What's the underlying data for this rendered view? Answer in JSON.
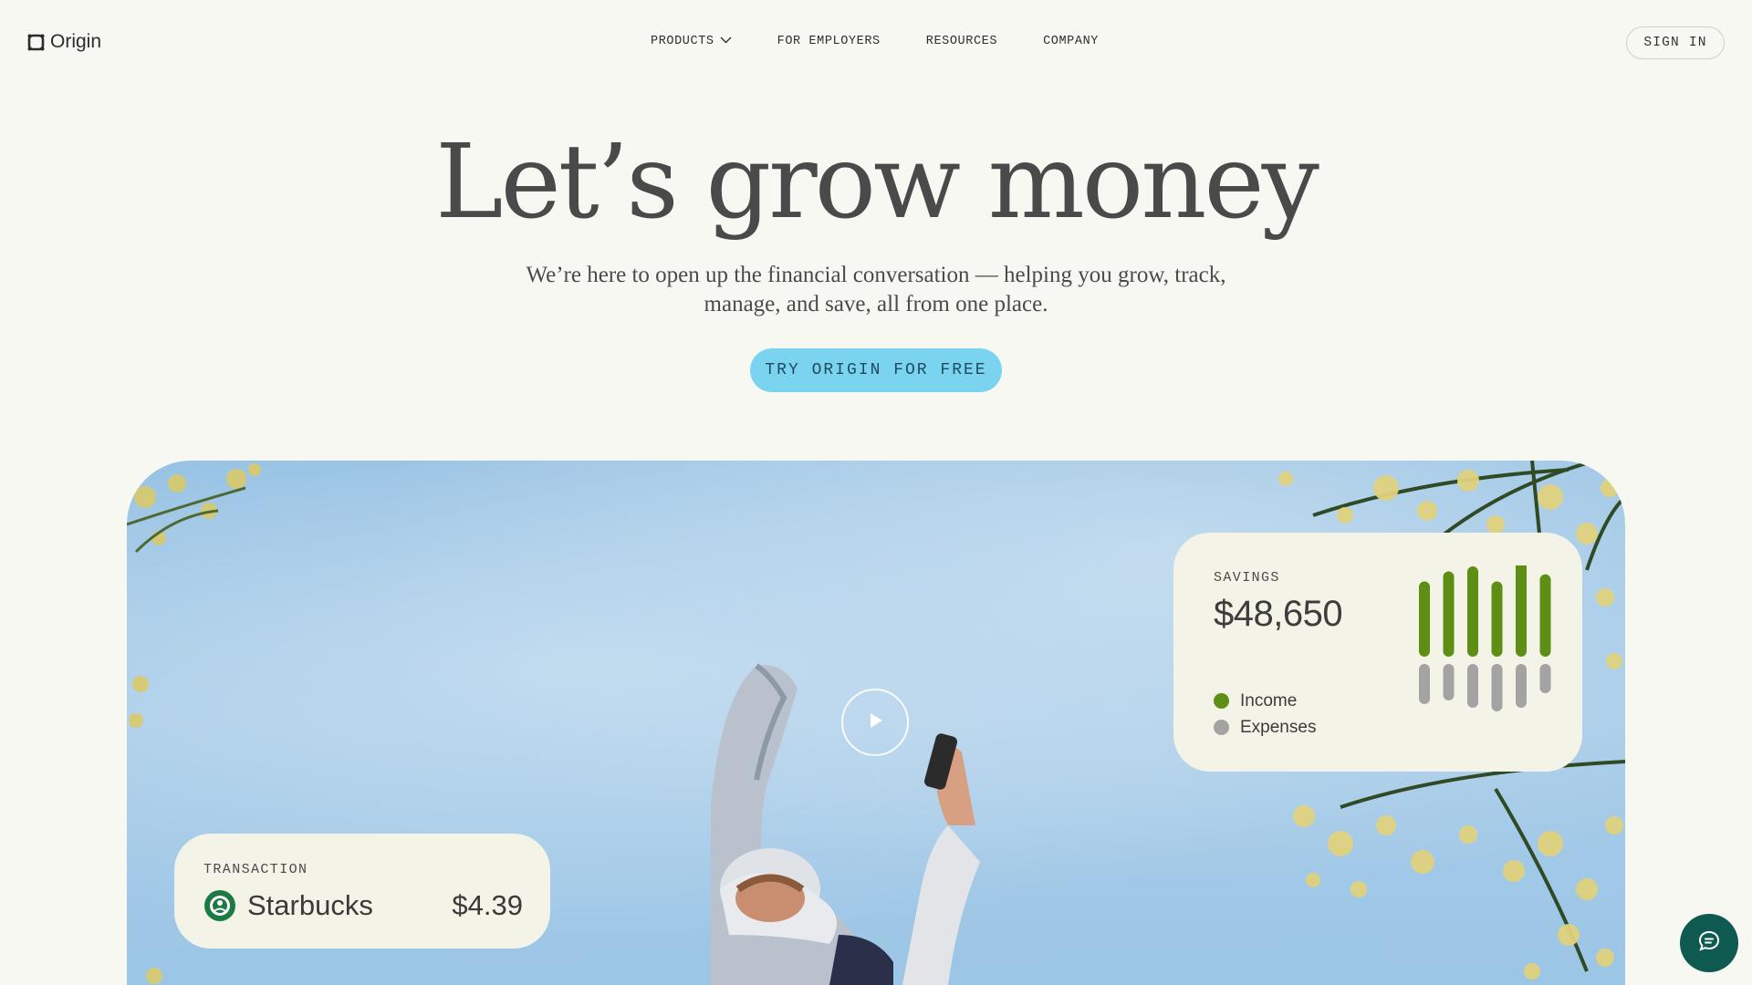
{
  "header": {
    "logo_text": "Origin",
    "nav": [
      {
        "label": "PRODUCTS",
        "has_dropdown": true
      },
      {
        "label": "FOR EMPLOYERS"
      },
      {
        "label": "RESOURCES"
      },
      {
        "label": "COMPANY"
      }
    ],
    "sign_in_label": "SIGN IN"
  },
  "hero": {
    "title": "Let’s grow money",
    "subtitle_line1": "We’re here to open up the financial conversation — helping you grow, track,",
    "subtitle_line2": "manage, and save, all from one place.",
    "cta_label": "TRY ORIGIN FOR FREE"
  },
  "media": {
    "play_icon": "play-icon",
    "savings_card": {
      "label": "SAVINGS",
      "amount": "$48,650",
      "legend": [
        {
          "label": "Income",
          "color": "#5e8f14"
        },
        {
          "label": "Expenses",
          "color": "#a3a3a3"
        }
      ],
      "income_bars": [
        0.75,
        0.85,
        0.9,
        0.75,
        0.95,
        0.82
      ],
      "expense_bars": [
        0.55,
        0.5,
        0.6,
        0.65,
        0.6,
        0.4
      ]
    },
    "transaction_card": {
      "label": "TRANSACTION",
      "merchant": "Starbucks",
      "amount": "$4.39",
      "logo_icon": "starbucks-logo-icon"
    }
  },
  "chat_icon": "chat-bubble-icon",
  "colors": {
    "background": "#f8f8f3",
    "cta": "#7ad3ef",
    "income": "#5e8f14",
    "expenses": "#a3a3a3",
    "chat": "#0e5a51"
  }
}
